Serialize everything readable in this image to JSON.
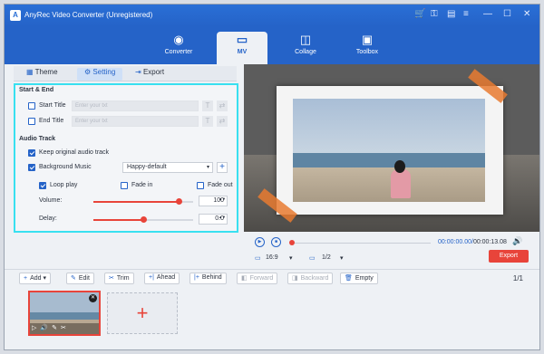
{
  "app": {
    "title": "AnyRec Video Converter (Unregistered)",
    "logo": "A"
  },
  "window_controls": {
    "cart": "🛒",
    "key": "⚿",
    "chat": "▤",
    "menu": "≡",
    "minimize": "—",
    "maximize": "☐",
    "close": "✕"
  },
  "nav": {
    "tabs": [
      {
        "label": "Converter",
        "icon": "◉"
      },
      {
        "label": "MV",
        "icon": "▭"
      },
      {
        "label": "Collage",
        "icon": "◫"
      },
      {
        "label": "Toolbox",
        "icon": "▣"
      }
    ]
  },
  "subtabs": {
    "theme": "Theme",
    "setting": "Setting",
    "export": "Export",
    "theme_icon": "▦",
    "setting_icon": "⚙",
    "export_icon": "⇥"
  },
  "start_end": {
    "header": "Start & End",
    "start_title": {
      "label": "Start Title",
      "placeholder": "Enter your txt",
      "checked": false
    },
    "end_title": {
      "label": "End Title",
      "placeholder": "Enter your txt",
      "checked": false
    },
    "text_btn": "T",
    "settings_btn": "⇄"
  },
  "audio": {
    "header": "Audio Track",
    "keep_original": {
      "label": "Keep original audio track",
      "checked": true
    },
    "background_music": {
      "label": "Background Music",
      "checked": true,
      "selected": "Happy-default",
      "add": "+"
    },
    "loop_play": {
      "label": "Loop play",
      "checked": true
    },
    "fade_in": {
      "label": "Fade in",
      "checked": false
    },
    "fade_out": {
      "label": "Fade out",
      "checked": false
    },
    "volume": {
      "label": "Volume:",
      "value": "100",
      "fraction": 0.85
    },
    "delay": {
      "label": "Delay:",
      "value": "0.0",
      "fraction": 0.5
    },
    "spinner": "▲▼"
  },
  "player": {
    "play_icon": "▶",
    "stop_icon": "■",
    "current_time": "00:00:00.00",
    "total_time": "00:00:13.08",
    "volume_icon": "🔊",
    "aspect": "16:9",
    "screen": "1/2",
    "dropdown": "▾",
    "export_label": "Export",
    "monitor_icon": "▭"
  },
  "toolbar": {
    "add": "Add",
    "edit": "Edit",
    "trim": "Trim",
    "ahead": "Ahead",
    "behind": "Behind",
    "forward": "Forward",
    "backward": "Backward",
    "empty": "Empty",
    "add_icon": "+",
    "edit_icon": "✎",
    "trim_icon": "✂",
    "ahead_icon": "+|",
    "behind_icon": "|+",
    "forward_icon": "◧",
    "backward_icon": "◨",
    "empty_icon": "🗑",
    "add_dropdown": "▾"
  },
  "page_indicator": "1/1",
  "timeline": {
    "clip_icons": "▷🔊✎✂",
    "clip_close": "✕",
    "add_slot": "+"
  },
  "colors": {
    "accent": "#2563c8",
    "highlight": "#38e0f0",
    "red": "#e8443a"
  }
}
